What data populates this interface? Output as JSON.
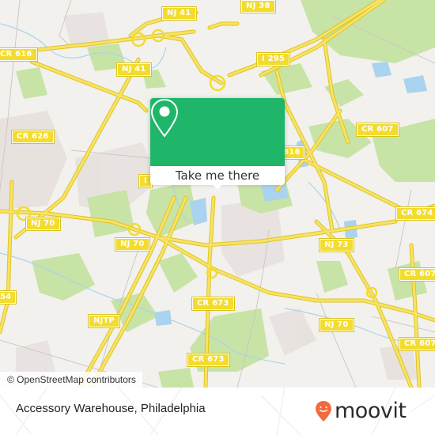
{
  "map": {
    "attribution": "© OpenStreetMap contributors",
    "colors": {
      "background": "#f2f1ed",
      "park": "#c8e3a6",
      "water": "#a9d3ee",
      "road": "#f3dc2d",
      "residential": "#e6e0dc",
      "accent": "#20b66a"
    },
    "road_labels": [
      {
        "id": "nj41-top",
        "text": "NJ 41"
      },
      {
        "id": "nj38",
        "text": "NJ 38"
      },
      {
        "id": "cr616-left",
        "text": "CR 616"
      },
      {
        "id": "i295",
        "text": "I 295"
      },
      {
        "id": "nj41-mid",
        "text": "NJ 41"
      },
      {
        "id": "cr626",
        "text": "CR 626"
      },
      {
        "id": "cr607-top",
        "text": "CR 607"
      },
      {
        "id": "cr616-right",
        "text": "616"
      },
      {
        "id": "hidden-left",
        "text": "I"
      },
      {
        "id": "cr674",
        "text": "CR 674"
      },
      {
        "id": "nj70-left",
        "text": "NJ 70"
      },
      {
        "id": "nj70-mid",
        "text": "NJ 70"
      },
      {
        "id": "nj73",
        "text": "NJ 73"
      },
      {
        "id": "cr607-mid",
        "text": "CR 607"
      },
      {
        "id": "cr564",
        "text": "54"
      },
      {
        "id": "cr673-top",
        "text": "CR 673"
      },
      {
        "id": "njtp",
        "text": "NJTP"
      },
      {
        "id": "nj70-right",
        "text": "NJ 70"
      },
      {
        "id": "cr607-bottom",
        "text": "CR 607"
      },
      {
        "id": "cr673-bottom",
        "text": "CR 673"
      }
    ]
  },
  "popup": {
    "icon": "map-pin-icon",
    "button_label": "Take me there"
  },
  "footer": {
    "place_name": "Accessory Warehouse, Philadelphia",
    "logo_text": "moovit",
    "logo_icon": "moovit-smiley-pin-icon",
    "logo_color": "#f26a3d"
  }
}
